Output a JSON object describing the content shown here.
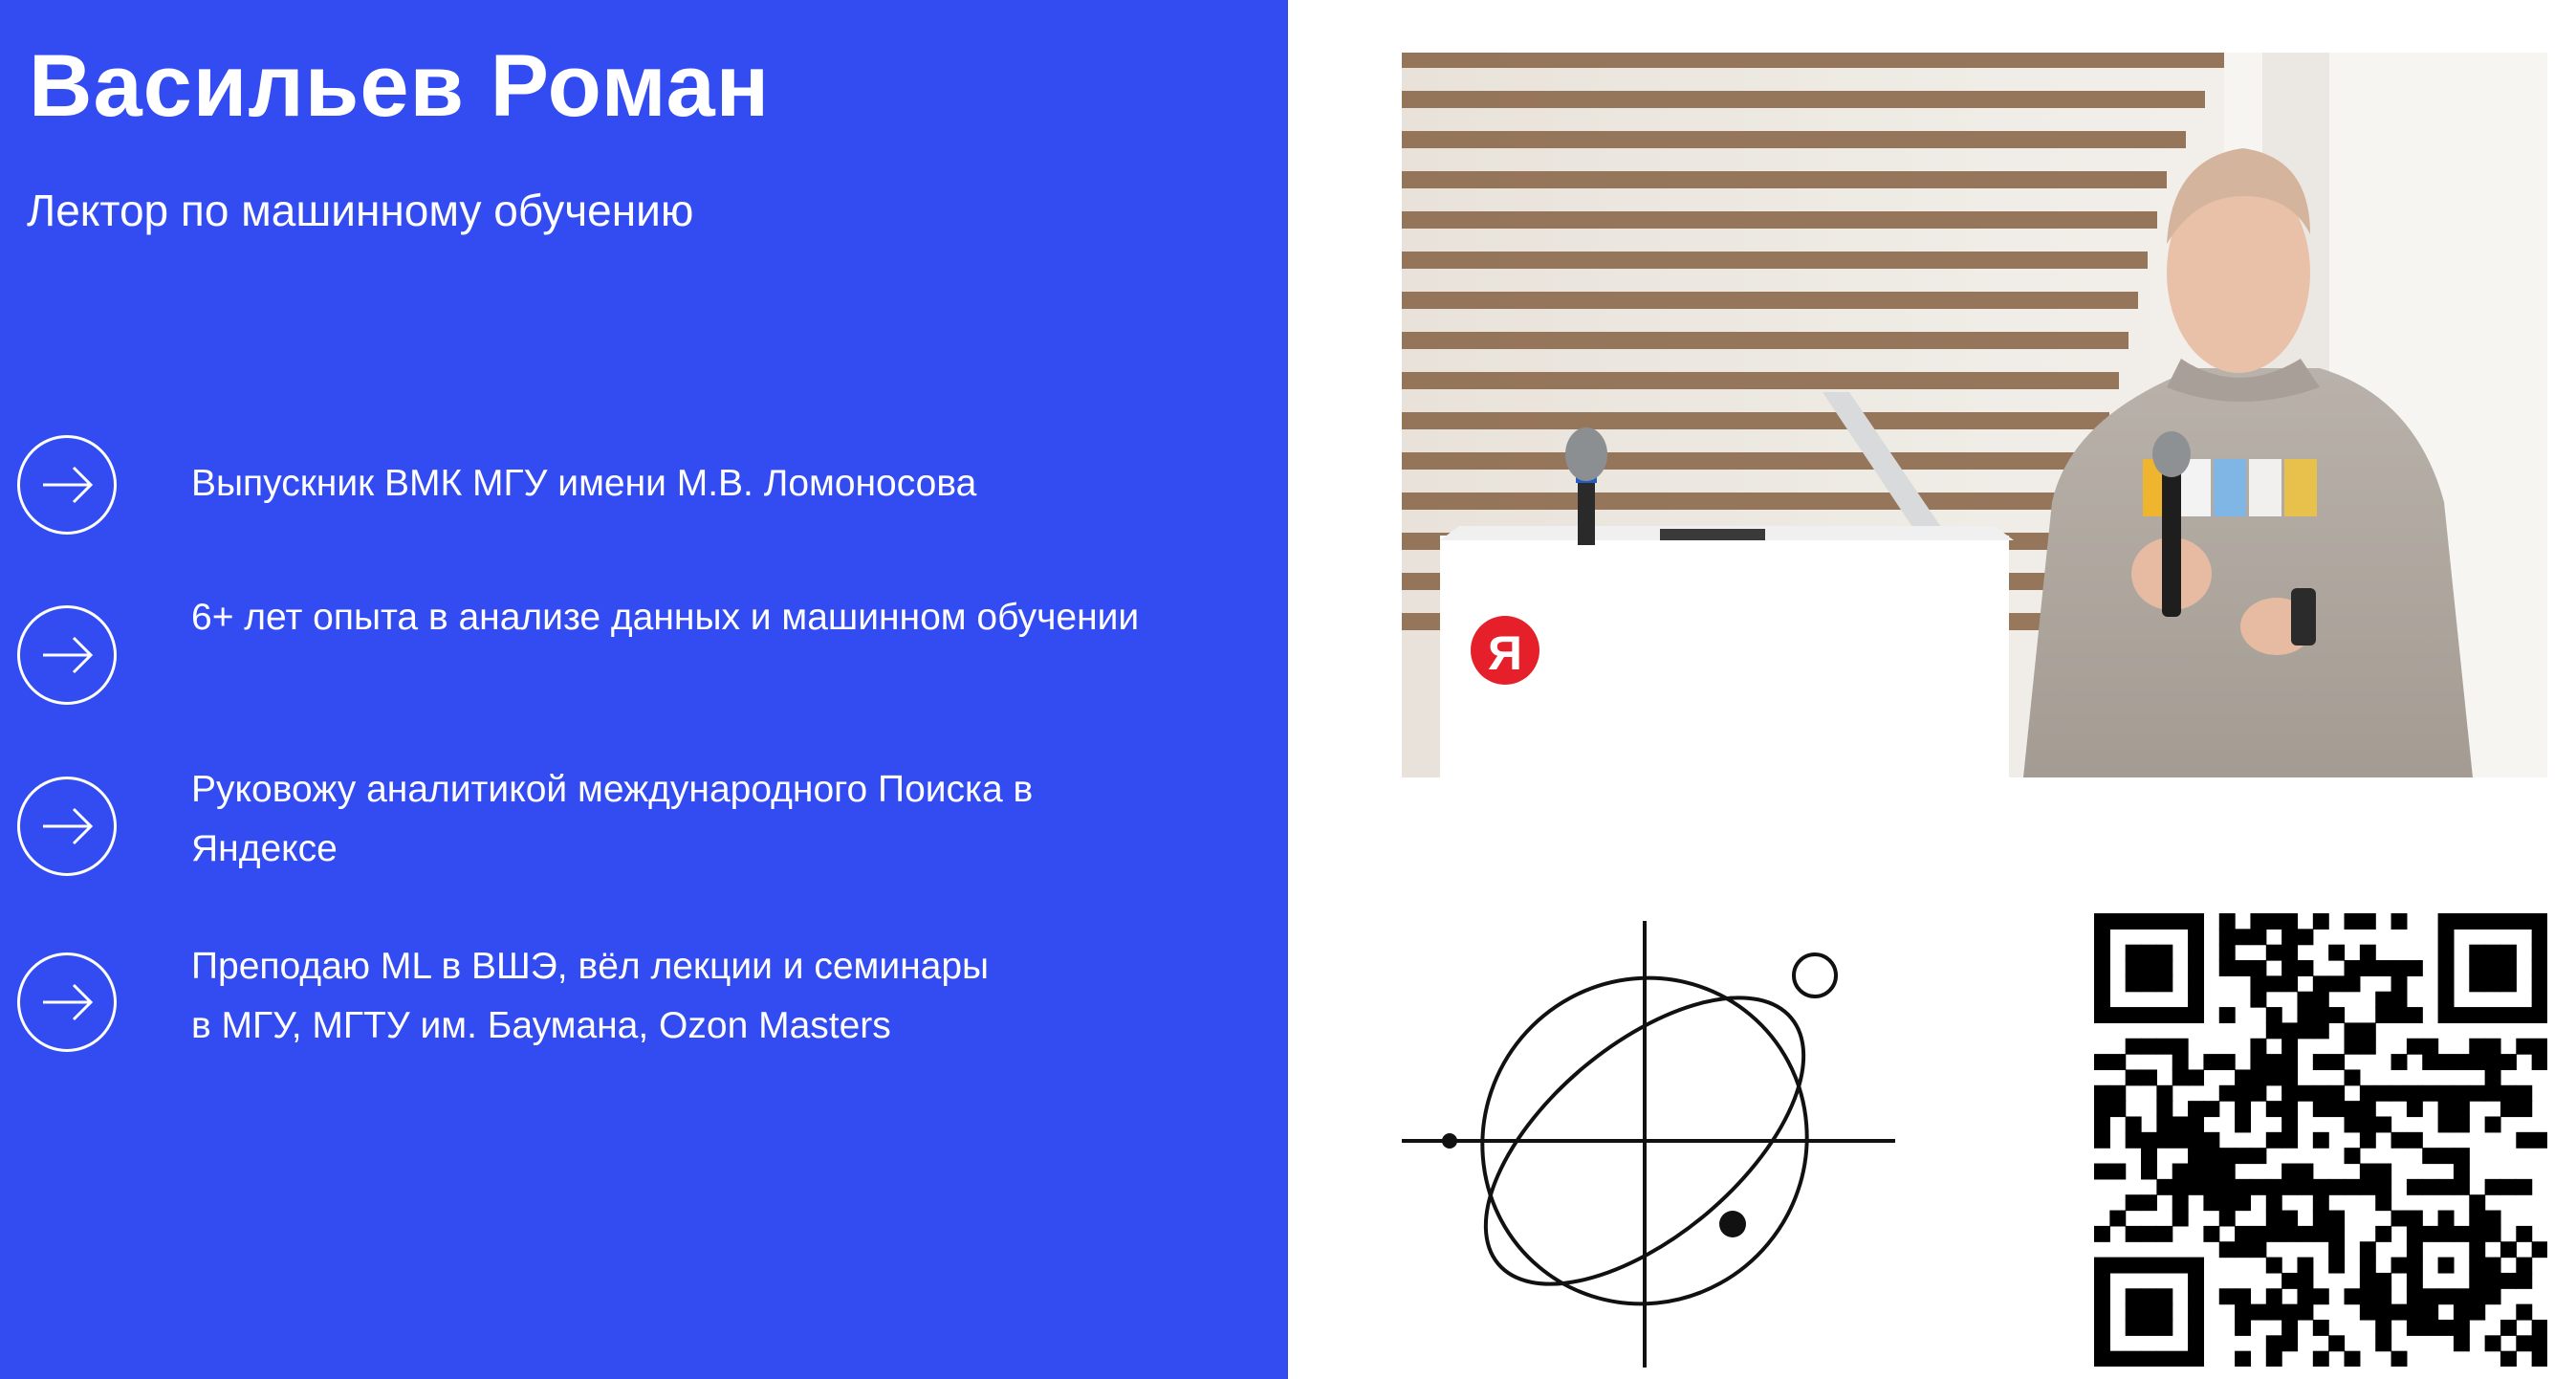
{
  "speaker": {
    "name": "Васильев Роман",
    "role": "Лектор по машинному обучению"
  },
  "facts": [
    {
      "lines": [
        "Выпускник ВМК МГУ имени М.В. Ломоносова"
      ]
    },
    {
      "lines": [
        "6+ лет опыта в анализе данных и машинном обучении"
      ]
    },
    {
      "lines": [
        "Руковожу аналитикой международного Поиска в",
        "Яндексе"
      ]
    },
    {
      "lines": [
        "Преподаю ML в ВШЭ, вёл лекции и семинары",
        "в МГУ, МГТУ им. Баумана, Ozon Masters"
      ]
    }
  ],
  "photo": {
    "badge_letter": "Я"
  },
  "icons": {
    "bullet": "arrow-right-icon",
    "logo": "orbit-logo",
    "qr": "qr-code"
  },
  "colors": {
    "panel": "#324cf2",
    "text": "#ffffff",
    "badge": "#e5202a"
  }
}
